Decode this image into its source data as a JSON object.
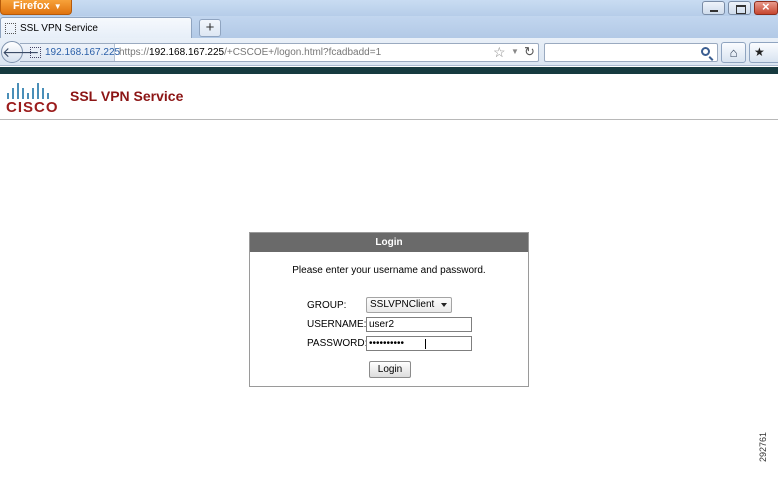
{
  "browser": {
    "app_menu_label": "Firefox",
    "tab_title": "SSL VPN Service",
    "new_tab_label": "+",
    "identity_domain": "192.168.167.225",
    "url_prefix": "https://",
    "url_host": "192.168.167.225",
    "url_path": "/+CSCOE+/logon.html?fcadbadd=1",
    "search_placeholder": ""
  },
  "header": {
    "logo_text": "CISCO",
    "title": "SSL VPN Service"
  },
  "login": {
    "header": "Login",
    "instructions": "Please enter your username and password.",
    "group_label": "GROUP:",
    "group_value": "SSLVPNClient",
    "username_label": "USERNAME:",
    "username_value": "user2",
    "password_label": "PASSWORD:",
    "password_value": "••••••••••",
    "button_label": "Login"
  },
  "figure_id": "292761",
  "colors": {
    "brand_red": "#8c1515",
    "accent_bar": "#163a3f",
    "login_header_bg": "#6a6a6a",
    "cisco_bars": "#4a8fb8"
  },
  "icons": [
    "back-arrow-icon",
    "star-icon",
    "reload-icon",
    "search-icon",
    "home-icon",
    "bookmarks-icon",
    "dropdown-icon"
  ]
}
